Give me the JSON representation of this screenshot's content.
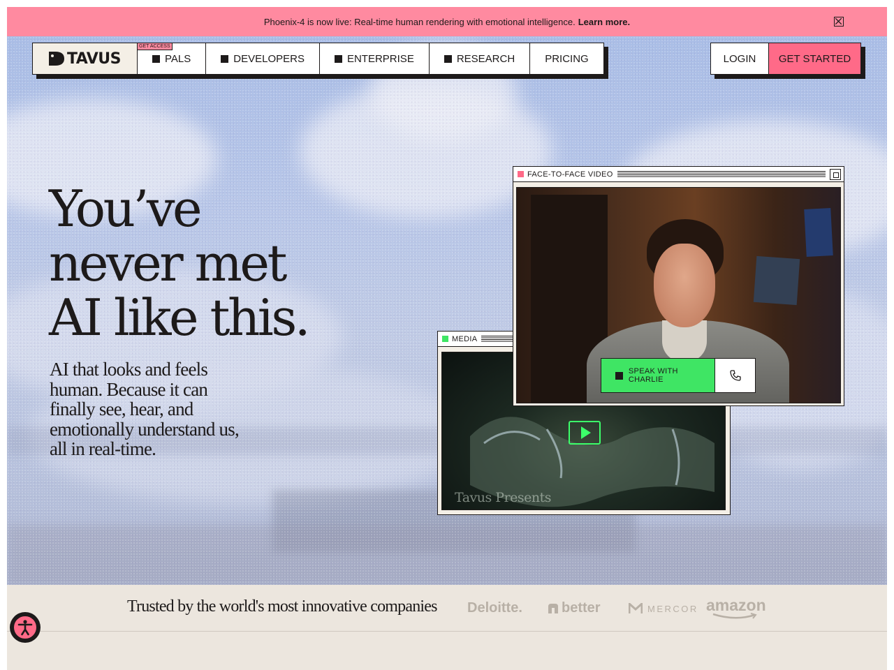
{
  "banner": {
    "message": "Phoenix-4 is now live: Real-time human rendering with emotional intelligence.",
    "link": "Learn more.",
    "close_icon": "close-x-icon"
  },
  "nav": {
    "logo_text": "TAVUS",
    "badge": "GET ACCESS",
    "items": [
      {
        "label": "PALS"
      },
      {
        "label": "DEVELOPERS"
      },
      {
        "label": "ENTERPRISE"
      },
      {
        "label": "RESEARCH"
      },
      {
        "label": "PRICING"
      }
    ],
    "login": "LOGIN",
    "get_started": "GET STARTED"
  },
  "hero": {
    "headline": [
      "You’ve",
      "never met",
      "AI like this."
    ],
    "subheadline": [
      "AI that looks and feels",
      "human. Because it can",
      "finally see, hear, and",
      "emotionally understand us,",
      "all in real-time."
    ]
  },
  "windows": {
    "media": {
      "title": "MEDIA",
      "dot_color": "#3fe564",
      "caption": "Tavus Presents",
      "play_icon": "play-icon"
    },
    "face_to_face": {
      "title": "FACE-TO-FACE VIDEO",
      "dot_color": "#ff6a88",
      "maximize_icon": "maximize-icon"
    }
  },
  "speak": {
    "label": "SPEAK WITH CHARLIE",
    "phone_icon": "phone-icon"
  },
  "trusted": {
    "label": "Trusted by the world's most innovative companies",
    "logos": [
      "Deloitte.",
      "better",
      "MERCOR",
      "amazon"
    ]
  },
  "colors": {
    "accent_pink": "#ff6a88",
    "banner_pink": "#ff8aa0",
    "accent_green": "#3fe564",
    "ink": "#1d1a1a"
  }
}
